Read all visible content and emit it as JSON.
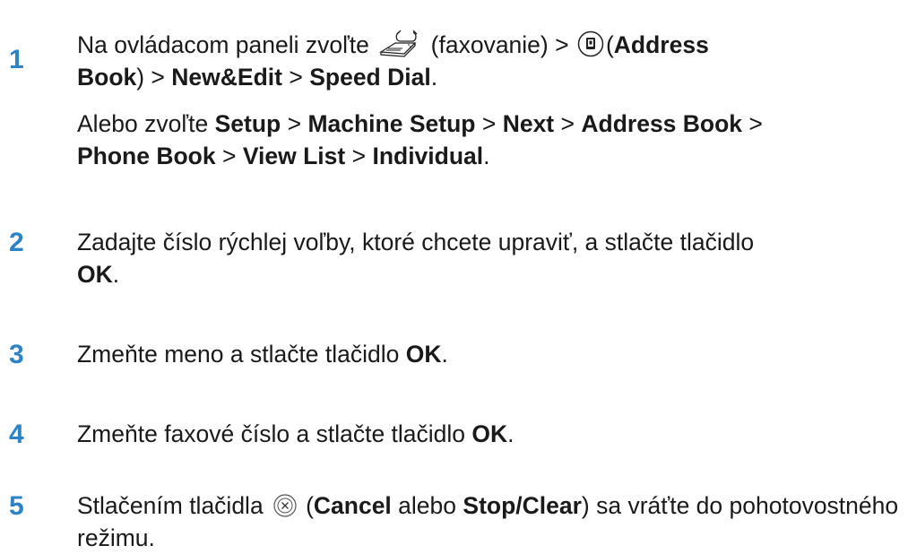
{
  "steps": [
    {
      "num": "1",
      "line1_prefix": "Na ovládacom paneli zvoľte",
      "line1_fax": "(faxovanie) >",
      "line1_paren_open": "(",
      "address_book": "Address",
      "line2_address_book": "Book",
      "line2_sep1": ") >",
      "new_edit": "New&Edit",
      "sep2": ">",
      "speed_dial": "Speed Dial",
      "end": ".",
      "alt_prefix": "Alebo zvoľte",
      "alt_setup": "Setup",
      "alt_sep1": ">",
      "alt_machine_setup": "Machine Setup",
      "alt_sep2": ">",
      "alt_next": "Next",
      "alt_sep3": ">",
      "alt_address_book": "Address Book",
      "alt_sep4": ">",
      "alt_phone_book": "Phone Book",
      "alt_sep5": ">",
      "alt_view_list": "View List",
      "alt_sep6": ">",
      "alt_individual": "Individual",
      "alt_end": "."
    },
    {
      "num": "2",
      "text": "Zadajte číslo rýchlej voľby, ktoré chcete upraviť, a stlačte tlačidlo",
      "ok": "OK",
      "end": "."
    },
    {
      "num": "3",
      "text": "Zmeňte meno a stlačte tlačidlo",
      "ok": "OK",
      "end": "."
    },
    {
      "num": "4",
      "text": "Zmeňte faxové číslo a stlačte tlačidlo",
      "ok": "OK",
      "end": "."
    },
    {
      "num": "5",
      "text_prefix": "Stlačením tlačidla",
      "paren_open": "(",
      "cancel": "Cancel",
      "mid": "alebo",
      "stop_clear": "Stop/Clear",
      "suffix": ") sa vráťte do pohotovostného režimu."
    }
  ],
  "icons": {
    "fax": "fax-icon",
    "address_book": "address-book-icon",
    "cancel": "cancel-icon"
  },
  "colors": {
    "step_number": "#2b83c9",
    "text": "#1a1a1a"
  }
}
